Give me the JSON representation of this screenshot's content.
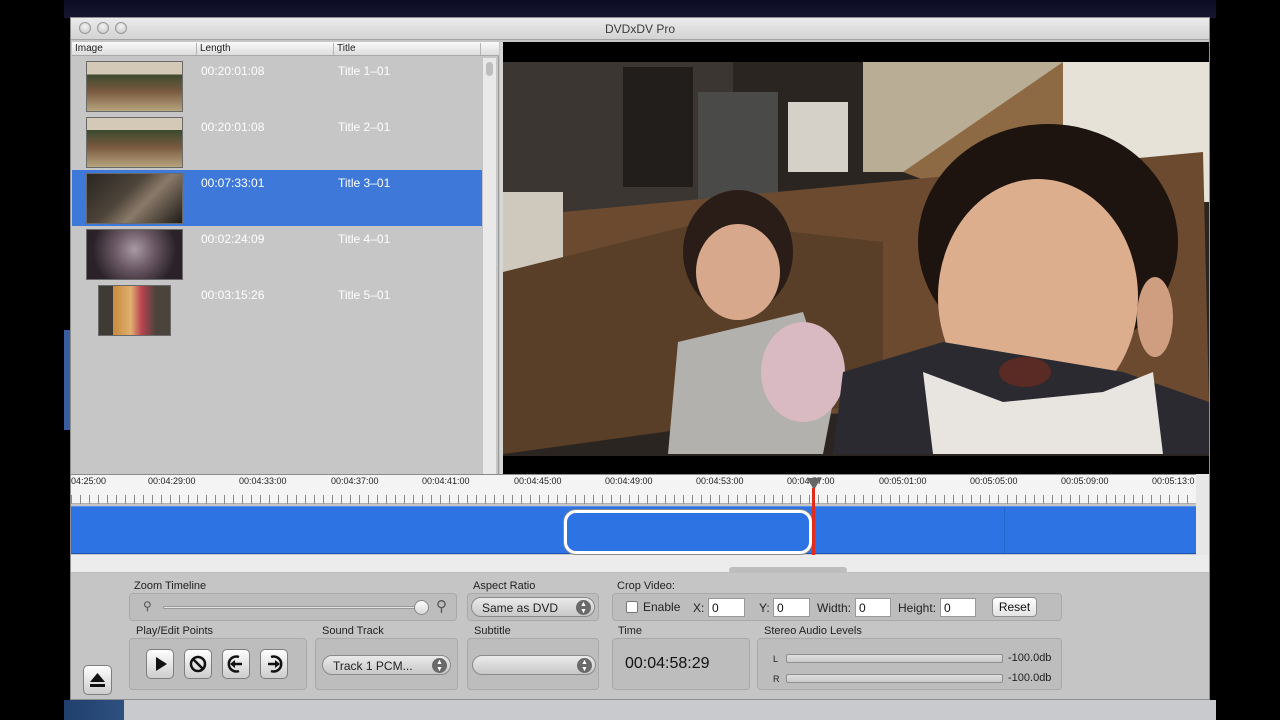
{
  "window": {
    "title": "DVDxDV Pro"
  },
  "list": {
    "columns": {
      "image": "Image",
      "length": "Length",
      "title": "Title"
    },
    "rows": [
      {
        "length": "00:20:01:08",
        "title": "Title 1–01",
        "selected": false
      },
      {
        "length": "00:20:01:08",
        "title": "Title 2–01",
        "selected": false
      },
      {
        "length": "00:07:33:01",
        "title": "Title 3–01",
        "selected": true
      },
      {
        "length": "00:02:24:09",
        "title": "Title 4–01",
        "selected": false
      },
      {
        "length": "00:03:15:26",
        "title": "Title 5–01",
        "selected": false
      }
    ]
  },
  "timeline": {
    "ticks": [
      "04:25:00",
      "00:04:29:00",
      "00:04:33:00",
      "00:04:37:00",
      "00:04:41:00",
      "00:04:45:00",
      "00:04:49:00",
      "00:04:53:00",
      "00:04:57:00",
      "00:05:01:00",
      "00:05:05:00",
      "00:05:09:00",
      "00:05:13:0"
    ],
    "playhead_time": "00:04:58:29"
  },
  "controls": {
    "zoom_label": "Zoom Timeline",
    "zoom_level": 1.0,
    "aspect_label": "Aspect Ratio",
    "aspect_value": "Same as DVD",
    "crop_label": "Crop Video:",
    "crop_enable": "Enable",
    "crop_x_label": "X:",
    "crop_x": "0",
    "crop_y_label": "Y:",
    "crop_y": "0",
    "crop_w_label": "Width:",
    "crop_w": "0",
    "crop_h_label": "Height:",
    "crop_h": "0",
    "reset": "Reset",
    "play_label": "Play/Edit Points",
    "sound_label": "Sound Track",
    "sound_value": "Track 1 PCM...",
    "subtitle_label": "Subtitle",
    "subtitle_value": "",
    "time_label": "Time",
    "time_value": "00:04:58:29",
    "audio_label": "Stereo Audio Levels",
    "left_ch": "L",
    "right_ch": "R",
    "left_db": "-100.0db",
    "right_db": "-100.0db"
  },
  "colors": {
    "selection": "#3e79d9",
    "timeline": "#2d73e3",
    "playhead": "#e12b1c"
  }
}
